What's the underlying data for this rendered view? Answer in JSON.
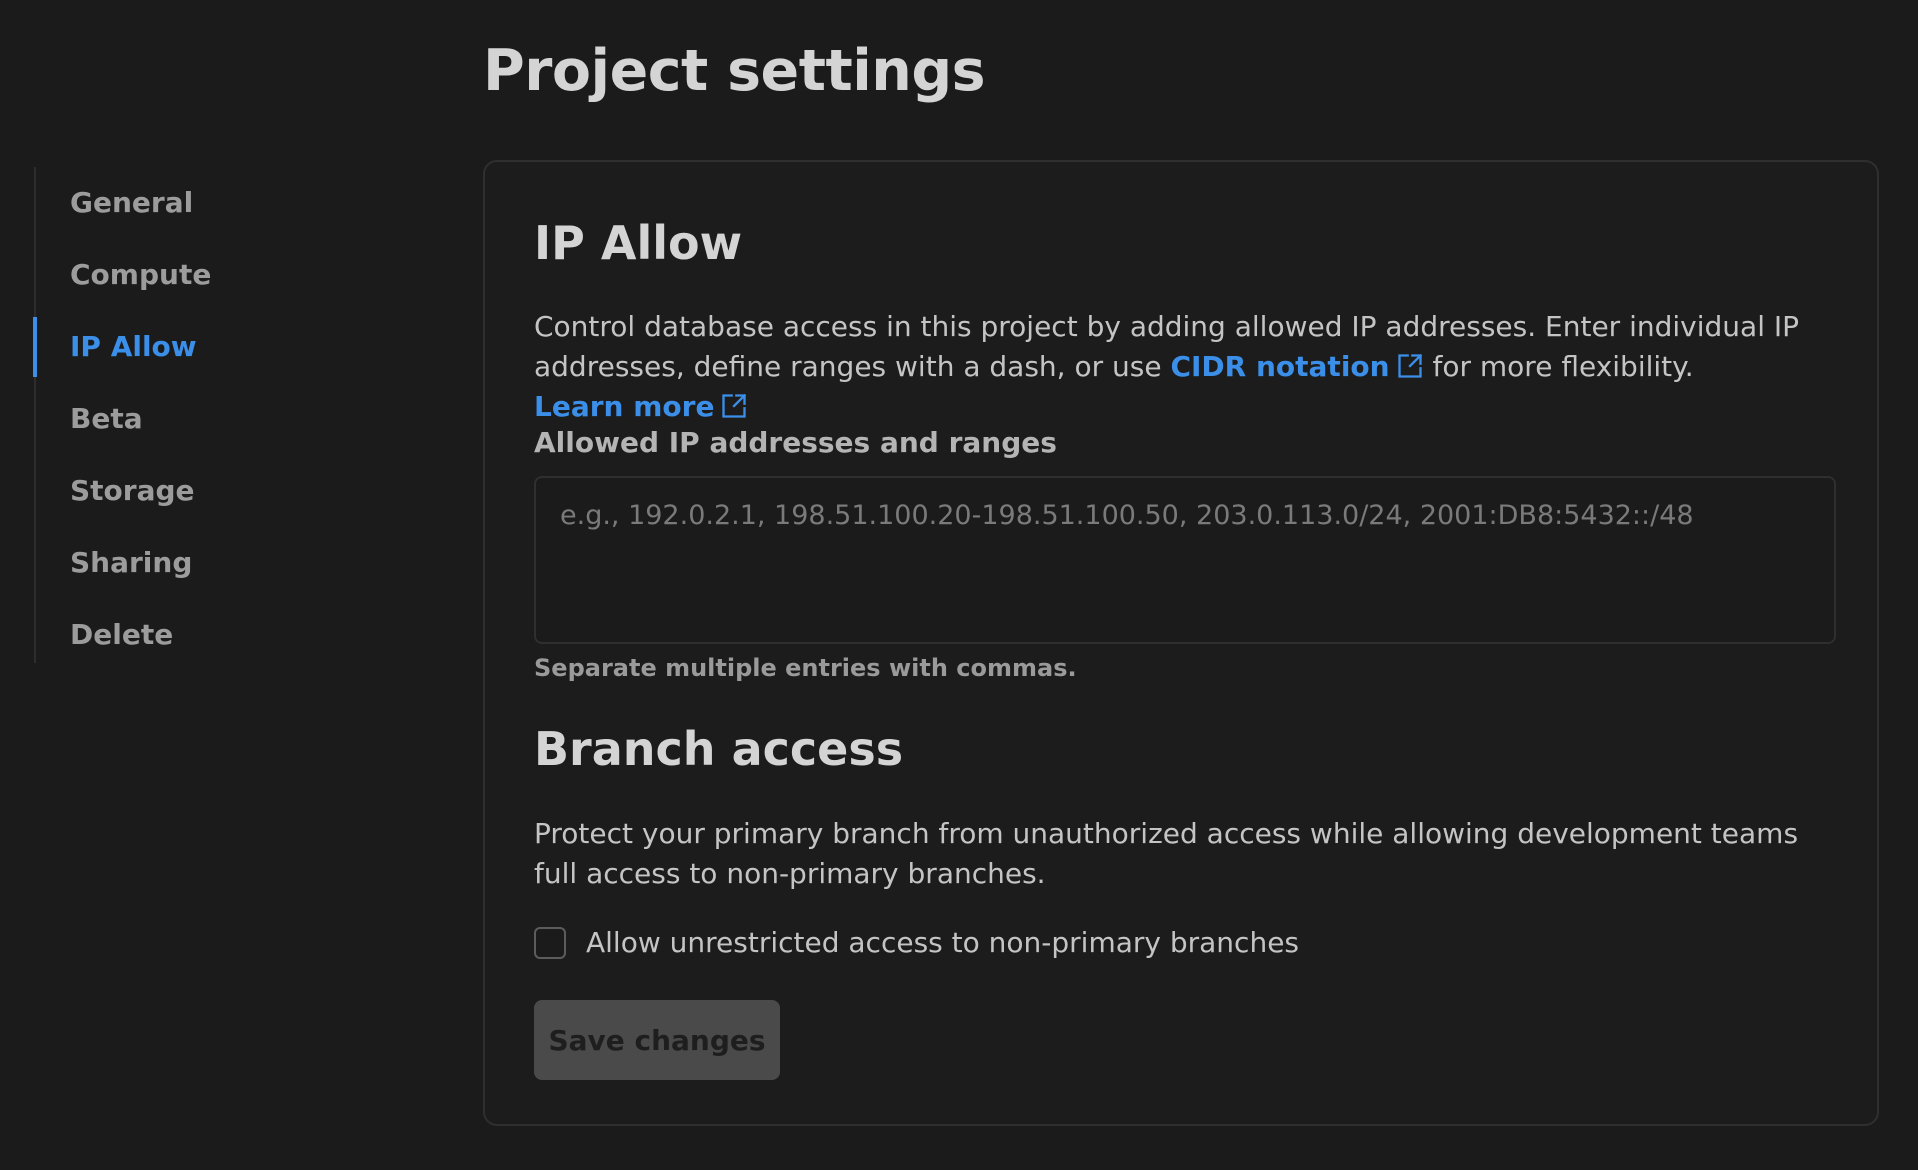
{
  "page": {
    "title": "Project settings"
  },
  "sidebar": {
    "items": [
      {
        "label": "General"
      },
      {
        "label": "Compute"
      },
      {
        "label": "IP Allow",
        "active": true
      },
      {
        "label": "Beta"
      },
      {
        "label": "Storage"
      },
      {
        "label": "Sharing"
      },
      {
        "label": "Delete"
      }
    ]
  },
  "ip_allow": {
    "title": "IP Allow",
    "desc_part1": "Control database access in this project by adding allowed IP addresses. Enter individual IP addresses, define ranges with a dash, or use ",
    "cidr_link": "CIDR notation",
    "desc_part2": " for more flexibility. ",
    "learn_more_link": "Learn more",
    "field_label": "Allowed IP addresses and ranges",
    "field_value": "",
    "field_placeholder": "e.g., 192.0.2.1, 198.51.100.20-198.51.100.50, 203.0.113.0/24, 2001:DB8:5432::/48",
    "hint": "Separate multiple entries with commas."
  },
  "branch_access": {
    "title": "Branch access",
    "description": "Protect your primary branch from unauthorized access while allowing development teams full access to non-primary branches.",
    "checkbox_label": "Allow unrestricted access to non-primary branches",
    "checkbox_checked": false
  },
  "actions": {
    "save_label": "Save changes"
  },
  "colors": {
    "background": "#1b1b1b",
    "accent": "#3b8fe8",
    "border": "#2f2f2f",
    "button_disabled": "#4a4a4a"
  },
  "icons": {
    "external_link": "external-link-icon"
  }
}
